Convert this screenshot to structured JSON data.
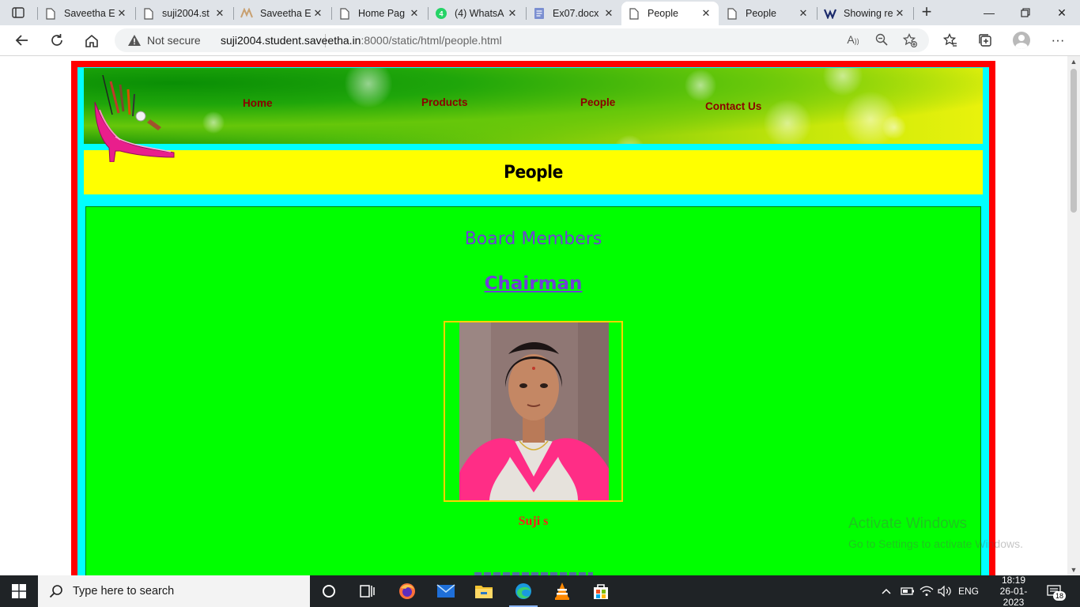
{
  "browser": {
    "tabs": [
      {
        "title": "Saveetha E",
        "icon": "page-icon",
        "active": false
      },
      {
        "title": "suji2004.st",
        "icon": "page-icon",
        "active": false
      },
      {
        "title": "Saveetha E",
        "icon": "saveetha-logo-icon",
        "active": false
      },
      {
        "title": "Home Pag",
        "icon": "page-icon",
        "active": false
      },
      {
        "title": "(4) WhatsA",
        "icon": "whatsapp-icon",
        "active": false
      },
      {
        "title": "Ex07.docx",
        "icon": "document-icon",
        "active": false
      },
      {
        "title": "People",
        "icon": "page-icon",
        "active": true
      },
      {
        "title": "People",
        "icon": "page-icon",
        "active": false
      },
      {
        "title": "Showing re",
        "icon": "app-logo-icon",
        "active": false
      }
    ],
    "security_label": "Not secure",
    "url_host": "suji2004.student.saveetha.in",
    "url_path": ":8000/static/html/people.html"
  },
  "site": {
    "menu": [
      "Home",
      "Products",
      "People",
      "Contact Us"
    ],
    "page_title": "People",
    "section_heading": "Board Members",
    "role": "Chairman",
    "member_name": "Suji s"
  },
  "watermark": {
    "line1": "Activate Windows",
    "line2": "Go to Settings to activate Windows."
  },
  "taskbar": {
    "search_placeholder": "Type here to search",
    "language": "ENG",
    "time": "18:19",
    "date": "26-01-2023",
    "notification_count": "18"
  }
}
